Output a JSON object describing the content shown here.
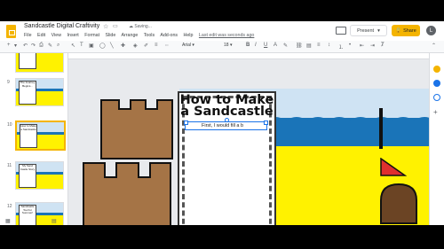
{
  "app": {
    "title": "Sandcastle Digital Craftivity",
    "saving": "Saving...",
    "last_edit": "Last edit was seconds ago",
    "menus": [
      "File",
      "Edit",
      "View",
      "Insert",
      "Format",
      "Slide",
      "Arrange",
      "Tools",
      "Add-ons",
      "Help"
    ],
    "present_label": "Present",
    "share_label": "Share",
    "avatar_letter": "L"
  },
  "toolbar": {
    "font": "Arial",
    "font_size": "18"
  },
  "filmstrip": {
    "slides": [
      {
        "num": "",
        "text": ""
      },
      {
        "num": "",
        "text": "The Journey Begins..."
      },
      {
        "num": "",
        "text": "How to Make a Sandcastle"
      },
      {
        "num": "",
        "text": "My Sand Castle Story"
      },
      {
        "num": "",
        "text": "Sandcastle Tool for Summer!"
      }
    ]
  },
  "slide": {
    "card_title_line1": "How to Make",
    "card_title_line2": "a Sandcastle",
    "textbox_text": "First, I would fill a b"
  },
  "colors": {
    "accent": "#f4b400",
    "sand": "#fff200",
    "sea": "#1a74b8",
    "sky": "#cfe3f3",
    "castle": "#a57446",
    "flag": "#e0302e",
    "door": "#6b4424"
  }
}
